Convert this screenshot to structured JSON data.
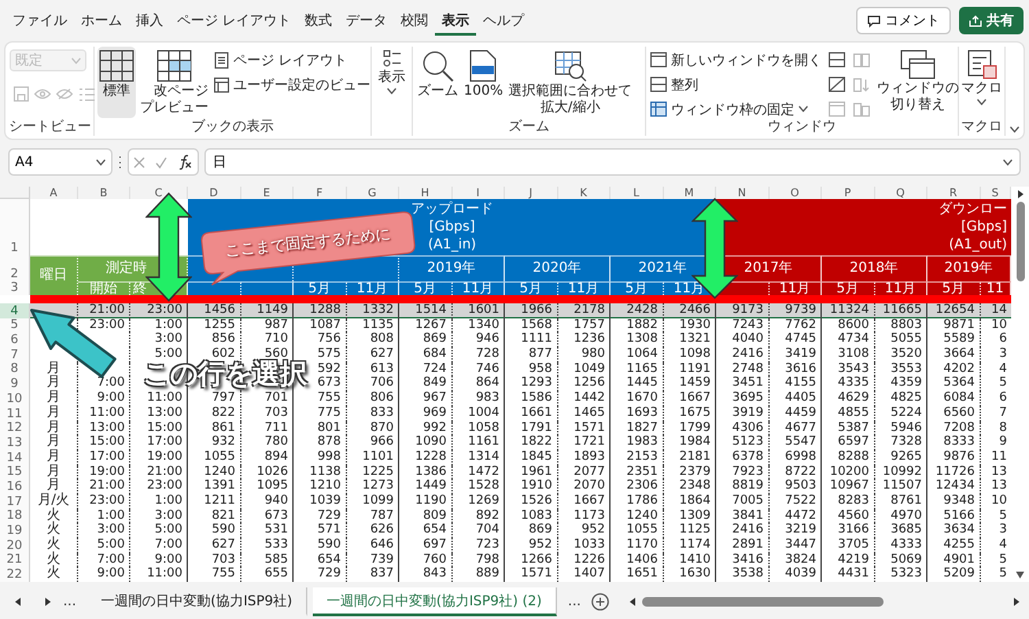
{
  "menu_tabs": [
    {
      "label": "ファイル",
      "selected": false
    },
    {
      "label": "ホーム",
      "selected": false
    },
    {
      "label": "挿入",
      "selected": false
    },
    {
      "label": "ページ レイアウト",
      "selected": false
    },
    {
      "label": "数式",
      "selected": false
    },
    {
      "label": "データ",
      "selected": false
    },
    {
      "label": "校閲",
      "selected": false
    },
    {
      "label": "表示",
      "selected": true
    },
    {
      "label": "ヘルプ",
      "selected": false
    }
  ],
  "comment_button": "コメント",
  "share_button": "共有",
  "ribbon": {
    "sheet_view": {
      "label": "シートビュー",
      "view_select": {
        "value": "既定",
        "disabled": true
      }
    },
    "workbook_views": {
      "label": "ブックの表示",
      "items": [
        {
          "label": "標準",
          "selected": true
        },
        {
          "label": "改ページプレビュー",
          "selected": false
        },
        {
          "label": "ページ レイアウト",
          "selected": false
        },
        {
          "label": "ユーザー設定のビュー",
          "selected": false
        }
      ]
    },
    "show": {
      "button": "表示"
    },
    "zoom": {
      "label": "ズーム",
      "items": [
        "ズーム",
        "100%",
        "選択範囲に合わせて拡大/縮小"
      ]
    },
    "window": {
      "label": "ウィンドウ",
      "items": [
        "新しいウィンドウを開く",
        "整列",
        "ウィンドウ枠の固定",
        "ウィンドウの切り替え"
      ]
    },
    "macros": {
      "label": "マクロ",
      "button": "マクロ"
    }
  },
  "formula_bar": {
    "name_box": "A4",
    "formula": "日"
  },
  "sheet": {
    "columns": [
      "A",
      "B",
      "C",
      "D",
      "E",
      "F",
      "G",
      "H",
      "I",
      "J",
      "K",
      "L",
      "M",
      "N",
      "O",
      "P",
      "Q",
      "R",
      "S"
    ],
    "header_row_numbers": [
      "1",
      "2",
      "3"
    ],
    "day_header": "曜日",
    "time_header": "測定時",
    "start_header": "開始",
    "end_header": "終",
    "sections": [
      {
        "title_lines": [
          "アップロード",
          "[Gbps]",
          "(A1_in)"
        ],
        "color": "#0070c0",
        "years": [
          "2019年",
          "2020年",
          "2021年"
        ],
        "months": [
          "5月",
          "11月",
          "5月",
          "11月",
          "5月",
          "11月",
          "5月",
          "11月"
        ]
      },
      {
        "title_lines": [
          "ダウンロー",
          "[Gbps]",
          "(A1_out)"
        ],
        "color": "#c00000",
        "years": [
          "2017年",
          "2018年",
          "2019年"
        ],
        "months": [
          "11月",
          "5月",
          "11月",
          "5月",
          "11"
        ]
      }
    ],
    "rows": [
      {
        "number": "4",
        "selected": true,
        "cells": {
          "B": "21:00",
          "C": "23:00",
          "D": "1456",
          "E": "1149",
          "F": "1288",
          "G": "1332",
          "H": "1514",
          "I": "1601",
          "J": "1966",
          "K": "2178",
          "L": "2428",
          "M": "2466",
          "N": "9173",
          "O": "9739",
          "P": "11324",
          "Q": "11665",
          "R": "12654",
          "S": "14"
        }
      },
      {
        "number": "5",
        "selected": false,
        "cells": {
          "B": "23:00",
          "C": "1:00",
          "D": "1255",
          "E": "987",
          "F": "1087",
          "G": "1135",
          "H": "1267",
          "I": "1340",
          "J": "1568",
          "K": "1757",
          "L": "1882",
          "M": "1930",
          "N": "7243",
          "O": "7762",
          "P": "8600",
          "Q": "8803",
          "R": "9871",
          "S": "10"
        }
      },
      {
        "number": "6",
        "selected": false,
        "cells": {
          "C": "3:00",
          "D": "856",
          "E": "710",
          "F": "756",
          "G": "808",
          "H": "869",
          "I": "946",
          "J": "1111",
          "K": "1236",
          "L": "1308",
          "M": "1321",
          "N": "4040",
          "O": "4745",
          "P": "4734",
          "Q": "5055",
          "R": "5589",
          "S": "6"
        }
      },
      {
        "number": "7",
        "selected": false,
        "cells": {
          "C": "5:00",
          "D": "602",
          "E": "560",
          "F": "575",
          "G": "627",
          "H": "684",
          "I": "728",
          "J": "877",
          "K": "980",
          "L": "1064",
          "M": "1098",
          "N": "2416",
          "O": "3419",
          "P": "3108",
          "Q": "3520",
          "R": "3664",
          "S": "3"
        }
      },
      {
        "number": "8",
        "selected": false,
        "cells": {
          "A": "月",
          "F": "592",
          "G": "613",
          "H": "724",
          "I": "746",
          "J": "958",
          "K": "1049",
          "L": "1165",
          "M": "1191",
          "N": "2748",
          "O": "3616",
          "P": "3543",
          "Q": "3553",
          "R": "4202",
          "S": "4"
        }
      },
      {
        "number": "9",
        "selected": false,
        "cells": {
          "A": "月",
          "B": "7:00",
          "F": "673",
          "G": "706",
          "H": "849",
          "I": "864",
          "J": "1293",
          "K": "1256",
          "L": "1445",
          "M": "1459",
          "N": "3451",
          "O": "4155",
          "P": "4335",
          "Q": "4359",
          "R": "5364",
          "S": "5"
        }
      },
      {
        "number": "10",
        "selected": false,
        "cells": {
          "A": "月",
          "B": "9:00",
          "C": "11:00",
          "D": "797",
          "E": "701",
          "F": "755",
          "G": "806",
          "H": "967",
          "I": "983",
          "J": "1586",
          "K": "1442",
          "L": "1670",
          "M": "1667",
          "N": "3695",
          "O": "4405",
          "P": "4629",
          "Q": "4825",
          "R": "6084",
          "S": "6"
        }
      },
      {
        "number": "11",
        "selected": false,
        "cells": {
          "A": "月",
          "B": "11:00",
          "C": "13:00",
          "D": "822",
          "E": "703",
          "F": "775",
          "G": "833",
          "H": "969",
          "I": "1004",
          "J": "1661",
          "K": "1465",
          "L": "1693",
          "M": "1675",
          "N": "3919",
          "O": "4459",
          "P": "4855",
          "Q": "5224",
          "R": "6560",
          "S": "7"
        }
      },
      {
        "number": "12",
        "selected": false,
        "cells": {
          "A": "月",
          "B": "13:00",
          "C": "15:00",
          "D": "861",
          "E": "711",
          "F": "801",
          "G": "870",
          "H": "992",
          "I": "1058",
          "J": "1791",
          "K": "1571",
          "L": "1827",
          "M": "1799",
          "N": "4306",
          "O": "4677",
          "P": "5387",
          "Q": "5946",
          "R": "7208",
          "S": "8"
        }
      },
      {
        "number": "13",
        "selected": false,
        "cells": {
          "A": "月",
          "B": "15:00",
          "C": "17:00",
          "D": "932",
          "E": "780",
          "F": "878",
          "G": "966",
          "H": "1090",
          "I": "1161",
          "J": "1822",
          "K": "1721",
          "L": "1983",
          "M": "1984",
          "N": "5123",
          "O": "5547",
          "P": "6597",
          "Q": "7328",
          "R": "8333",
          "S": "9"
        }
      },
      {
        "number": "14",
        "selected": false,
        "cells": {
          "A": "月",
          "B": "17:00",
          "C": "19:00",
          "D": "1055",
          "E": "894",
          "F": "998",
          "G": "1101",
          "H": "1228",
          "I": "1314",
          "J": "1845",
          "K": "1893",
          "L": "2153",
          "M": "2181",
          "N": "6378",
          "O": "6998",
          "P": "8288",
          "Q": "9265",
          "R": "9876",
          "S": "11"
        }
      },
      {
        "number": "15",
        "selected": false,
        "cells": {
          "A": "月",
          "B": "19:00",
          "C": "21:00",
          "D": "1240",
          "E": "1026",
          "F": "1138",
          "G": "1225",
          "H": "1386",
          "I": "1472",
          "J": "1961",
          "K": "2077",
          "L": "2351",
          "M": "2379",
          "N": "7923",
          "O": "8722",
          "P": "10200",
          "Q": "10992",
          "R": "11726",
          "S": "13"
        }
      },
      {
        "number": "16",
        "selected": false,
        "cells": {
          "A": "月",
          "B": "21:00",
          "C": "23:00",
          "D": "1391",
          "E": "1095",
          "F": "1210",
          "G": "1273",
          "H": "1449",
          "I": "1528",
          "J": "1910",
          "K": "2070",
          "L": "2306",
          "M": "2348",
          "N": "8819",
          "O": "9503",
          "P": "10967",
          "Q": "11507",
          "R": "12434",
          "S": "13"
        }
      },
      {
        "number": "17",
        "selected": false,
        "cells": {
          "A": "月/火",
          "B": "23:00",
          "C": "1:00",
          "D": "1211",
          "E": "940",
          "F": "1039",
          "G": "1099",
          "H": "1190",
          "I": "1269",
          "J": "1526",
          "K": "1667",
          "L": "1786",
          "M": "1864",
          "N": "7005",
          "O": "7522",
          "P": "8283",
          "Q": "8761",
          "R": "9348",
          "S": "10"
        }
      },
      {
        "number": "18",
        "selected": false,
        "cells": {
          "A": "火",
          "B": "1:00",
          "C": "3:00",
          "D": "821",
          "E": "673",
          "F": "729",
          "G": "787",
          "H": "809",
          "I": "892",
          "J": "1083",
          "K": "1173",
          "L": "1240",
          "M": "1309",
          "N": "3841",
          "O": "4472",
          "P": "4560",
          "Q": "4970",
          "R": "5166",
          "S": "5"
        }
      },
      {
        "number": "19",
        "selected": false,
        "cells": {
          "A": "火",
          "B": "3:00",
          "C": "5:00",
          "D": "590",
          "E": "531",
          "F": "571",
          "G": "626",
          "H": "654",
          "I": "704",
          "J": "869",
          "K": "952",
          "L": "1055",
          "M": "1125",
          "N": "2416",
          "O": "3219",
          "P": "3166",
          "Q": "3685",
          "R": "3634",
          "S": "3"
        }
      },
      {
        "number": "20",
        "selected": false,
        "cells": {
          "A": "火",
          "B": "5:00",
          "C": "7:00",
          "D": "627",
          "E": "533",
          "F": "590",
          "G": "646",
          "H": "697",
          "I": "723",
          "J": "952",
          "K": "1033",
          "L": "1170",
          "M": "1174",
          "N": "2891",
          "O": "3447",
          "P": "3705",
          "Q": "4333",
          "R": "4255",
          "S": "4"
        }
      },
      {
        "number": "21",
        "selected": false,
        "cells": {
          "A": "火",
          "B": "7:00",
          "C": "9:00",
          "D": "703",
          "E": "585",
          "F": "654",
          "G": "739",
          "H": "760",
          "I": "798",
          "J": "1266",
          "K": "1226",
          "L": "1406",
          "M": "1410",
          "N": "3416",
          "O": "3824",
          "P": "4219",
          "Q": "5069",
          "R": "4901",
          "S": "5"
        }
      },
      {
        "number": "22",
        "selected": false,
        "cells": {
          "A": "火",
          "B": "9:00",
          "C": "11:00",
          "D": "755",
          "E": "655",
          "F": "729",
          "G": "837",
          "H": "843",
          "I": "889",
          "J": "1571",
          "K": "1407",
          "L": "1651",
          "M": "1630",
          "N": "3538",
          "O": "4039",
          "P": "4431",
          "Q": "5323",
          "R": "5209",
          "S": "5"
        }
      }
    ]
  },
  "annotations": {
    "callout": "ここまで固定するために",
    "caption": "この行を選択"
  },
  "sheet_tabs": {
    "more_left": "...",
    "more_right": "...",
    "tabs": [
      {
        "label": "一週間の日中変動(協力ISP9社)",
        "selected": false
      },
      {
        "label": "一週間の日中変動(協力ISP9社) (2)",
        "selected": true
      }
    ]
  }
}
